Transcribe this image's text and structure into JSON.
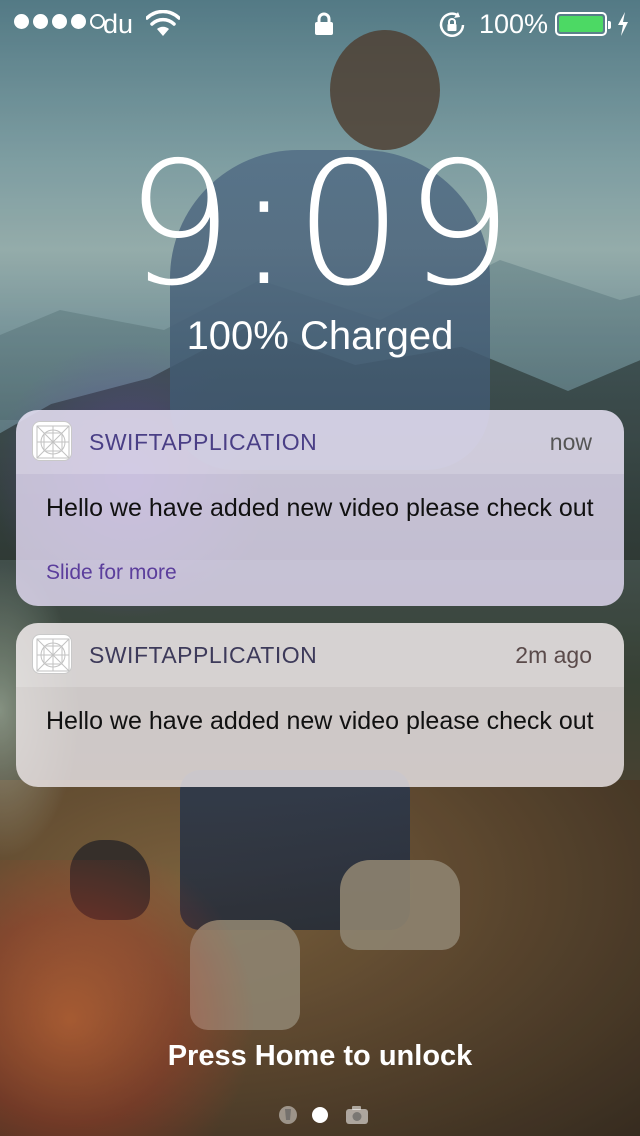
{
  "status_bar": {
    "signal_bars_filled": 4,
    "signal_bars_total": 5,
    "carrier": "du",
    "icons": [
      "wifi-icon",
      "lock-icon",
      "rotation-lock-icon",
      "battery-icon",
      "charging-bolt-icon"
    ],
    "battery_percent": "100%",
    "battery_level": 1.0,
    "battery_color": "#4cd964"
  },
  "lock_screen": {
    "time": "9:09",
    "charge_status": "100% Charged",
    "unlock_hint": "Press Home to unlock"
  },
  "notifications": [
    {
      "app_name": "SWIFTAPPLICATION",
      "time": "now",
      "message": "Hello we have added new video please check out",
      "action_hint": "Slide for more"
    },
    {
      "app_name": "SWIFTAPPLICATION",
      "time": "2m ago",
      "message": "Hello we have added new video please check out"
    }
  ],
  "page_indicator": {
    "items": [
      "flashlight-icon",
      "page-dot",
      "camera-icon"
    ],
    "active_index": 1
  }
}
